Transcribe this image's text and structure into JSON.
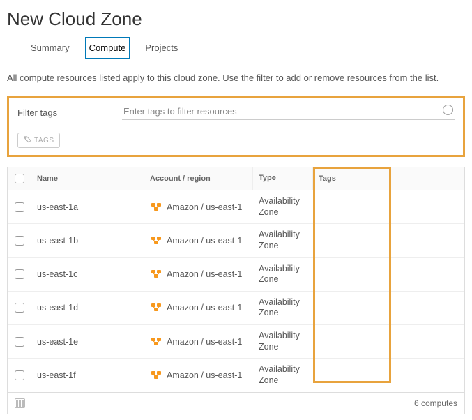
{
  "page_title": "New Cloud Zone",
  "tabs": [
    {
      "label": "Summary"
    },
    {
      "label": "Compute"
    },
    {
      "label": "Projects"
    }
  ],
  "active_tab_index": 1,
  "description": "All compute resources listed apply to this cloud zone. Use the filter to add or remove resources from the list.",
  "filter": {
    "label": "Filter tags",
    "placeholder": "Enter tags to filter resources",
    "tags_button": "TAGS"
  },
  "columns": {
    "name": "Name",
    "account": "Account / region",
    "type": "Type",
    "tags": "Tags"
  },
  "rows": [
    {
      "name": "us-east-1a",
      "account": "Amazon / us-east-1",
      "type": "Availability Zone",
      "tags": ""
    },
    {
      "name": "us-east-1b",
      "account": "Amazon / us-east-1",
      "type": "Availability Zone",
      "tags": ""
    },
    {
      "name": "us-east-1c",
      "account": "Amazon / us-east-1",
      "type": "Availability Zone",
      "tags": ""
    },
    {
      "name": "us-east-1d",
      "account": "Amazon / us-east-1",
      "type": "Availability Zone",
      "tags": ""
    },
    {
      "name": "us-east-1e",
      "account": "Amazon / us-east-1",
      "type": "Availability Zone",
      "tags": ""
    },
    {
      "name": "us-east-1f",
      "account": "Amazon / us-east-1",
      "type": "Availability Zone",
      "tags": ""
    }
  ],
  "footer": {
    "count_text": "6 computes"
  }
}
